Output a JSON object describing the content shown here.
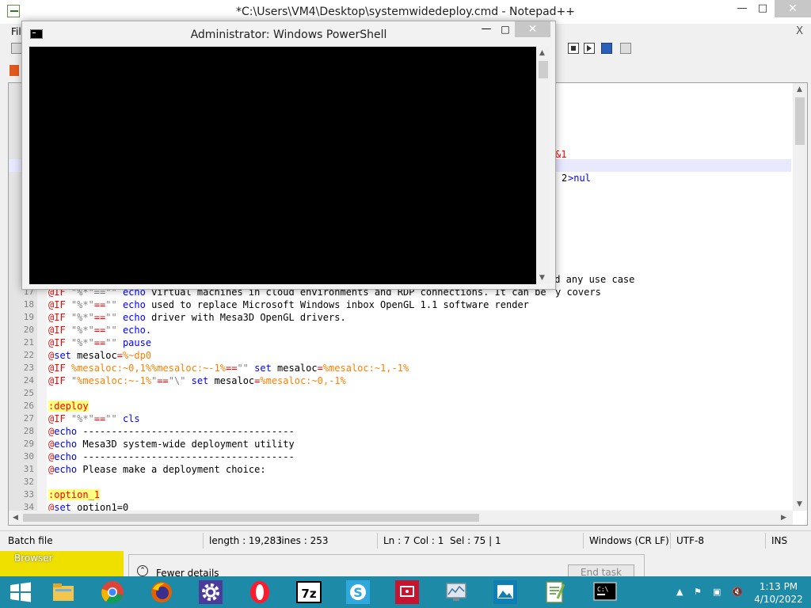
{
  "notepad": {
    "title": "*C:\\Users\\VM4\\Desktop\\systemwidedeploy.cmd - Notepad++",
    "menu_visible": "Fil",
    "close_glyph": "✕",
    "doc_close_glyph": "X"
  },
  "editor": {
    "fragments": {
      "r1": "&1",
      "r2a": "2",
      "r2b": ">nul",
      "r3": "nd any use case",
      "r4": "y covers"
    },
    "lines": [
      {
        "n": "17",
        "parts": [
          [
            "op",
            "@IF"
          ],
          [
            "st",
            " \"%*\"==\"\""
          ],
          [
            "kw",
            " echo"
          ],
          [
            "",
            ""
          ]
        ],
        "partial": "virtual machines in cloud environments and RDP connections. It can be"
      },
      {
        "n": "18",
        "parts": [
          [
            "op",
            "@IF"
          ],
          [
            "st",
            " \"%*\""
          ],
          [
            "op",
            "=="
          ],
          [
            "st",
            "\"\""
          ],
          [
            "kw",
            " echo"
          ],
          [
            "",
            ""
          ]
        ],
        "text": " used to replace Microsoft Windows inbox OpenGL 1.1 software render"
      },
      {
        "n": "19",
        "parts": [
          [
            "op",
            "@IF"
          ],
          [
            "st",
            " \"%*\""
          ],
          [
            "op",
            "=="
          ],
          [
            "st",
            "\"\""
          ],
          [
            "kw",
            " echo"
          ]
        ],
        "text": " driver with Mesa3D OpenGL drivers."
      },
      {
        "n": "20",
        "parts": [
          [
            "op",
            "@IF"
          ],
          [
            "st",
            " \"%*\""
          ],
          [
            "op",
            "=="
          ],
          [
            "st",
            "\"\""
          ],
          [
            "kw",
            " echo."
          ]
        ],
        "text": ""
      },
      {
        "n": "21",
        "parts": [
          [
            "op",
            "@IF"
          ],
          [
            "st",
            " \"%*\""
          ],
          [
            "op",
            "=="
          ],
          [
            "st",
            "\"\""
          ],
          [
            "kw",
            " pause"
          ]
        ],
        "text": ""
      },
      {
        "n": "22",
        "parts": [
          [
            "op",
            "@"
          ],
          [
            "kw",
            "set"
          ],
          [
            "",
            " mesaloc"
          ],
          [
            "op",
            "="
          ],
          [
            "vr",
            "%~dp0"
          ]
        ],
        "text": ""
      },
      {
        "n": "23",
        "parts": [
          [
            "op",
            "@IF"
          ],
          [
            "vr",
            " %mesaloc:~0,1%%mesaloc:~-1%"
          ],
          [
            "op",
            "=="
          ],
          [
            "st",
            "\"\""
          ],
          [
            "kw",
            " set"
          ],
          [
            "",
            " mesaloc"
          ],
          [
            "op",
            "="
          ],
          [
            "vr",
            "%mesaloc:~1,-1%"
          ]
        ],
        "text": ""
      },
      {
        "n": "24",
        "parts": [
          [
            "op",
            "@IF"
          ],
          [
            "st",
            " \""
          ],
          [
            "vr",
            "%mesaloc:~-1%"
          ],
          [
            "st",
            "\""
          ],
          [
            "op",
            "=="
          ],
          [
            "st",
            "\"\\\""
          ],
          [
            "kw",
            " set"
          ],
          [
            "",
            " mesaloc"
          ],
          [
            "op",
            "="
          ],
          [
            "vr",
            "%mesaloc:~0,-1%"
          ]
        ],
        "text": ""
      },
      {
        "n": "25",
        "parts": [],
        "text": ""
      },
      {
        "n": "26",
        "parts": [
          [
            "lb",
            ":deploy"
          ]
        ],
        "text": ""
      },
      {
        "n": "27",
        "parts": [
          [
            "op",
            "@IF"
          ],
          [
            "st",
            " \"%*\""
          ],
          [
            "op",
            "=="
          ],
          [
            "st",
            "\"\""
          ],
          [
            "kw",
            " cls"
          ]
        ],
        "text": ""
      },
      {
        "n": "28",
        "parts": [
          [
            "op",
            "@"
          ],
          [
            "kw",
            "echo"
          ]
        ],
        "text": " -------------------------------------"
      },
      {
        "n": "29",
        "parts": [
          [
            "op",
            "@"
          ],
          [
            "kw",
            "echo"
          ]
        ],
        "text": " Mesa3D system-wide deployment utility"
      },
      {
        "n": "30",
        "parts": [
          [
            "op",
            "@"
          ],
          [
            "kw",
            "echo"
          ]
        ],
        "text": " -------------------------------------"
      },
      {
        "n": "31",
        "parts": [
          [
            "op",
            "@"
          ],
          [
            "kw",
            "echo"
          ]
        ],
        "text": " Please make a deployment choice:"
      },
      {
        "n": "32",
        "parts": [],
        "text": ""
      },
      {
        "n": "33",
        "parts": [
          [
            "lb",
            ":option_1"
          ]
        ],
        "text": ""
      },
      {
        "n": "34",
        "parts": [
          [
            "op",
            "@"
          ],
          [
            "kw",
            "set"
          ]
        ],
        "text": " option1=0"
      }
    ]
  },
  "statusbar": {
    "type": "Batch file",
    "length": "length : 19,283",
    "lines": "lines : 253",
    "ln": "Ln : 7",
    "col": "Col : 1",
    "sel": "Sel : 75 | 1",
    "eol": "Windows (CR LF)",
    "encoding": "UTF-8",
    "mode": "INS"
  },
  "background": {
    "browser_label": "Browser",
    "fewer_details": "Fewer details",
    "end_task": "End task"
  },
  "powershell": {
    "title": "Administrator: Windows PowerShell",
    "close_glyph": "✕"
  },
  "taskbar": {
    "time": "1:13 PM",
    "date": "4/10/2022",
    "apps": [
      "start-icon",
      "file-explorer-icon",
      "chrome-icon",
      "firefox-icon",
      "settings-icon",
      "opera-icon",
      "7zip-icon",
      "skype-icon",
      "remote-desktop-icon",
      "network-monitor-icon",
      "photo-viewer-icon",
      "notepadpp-icon",
      "powershell-icon"
    ]
  }
}
